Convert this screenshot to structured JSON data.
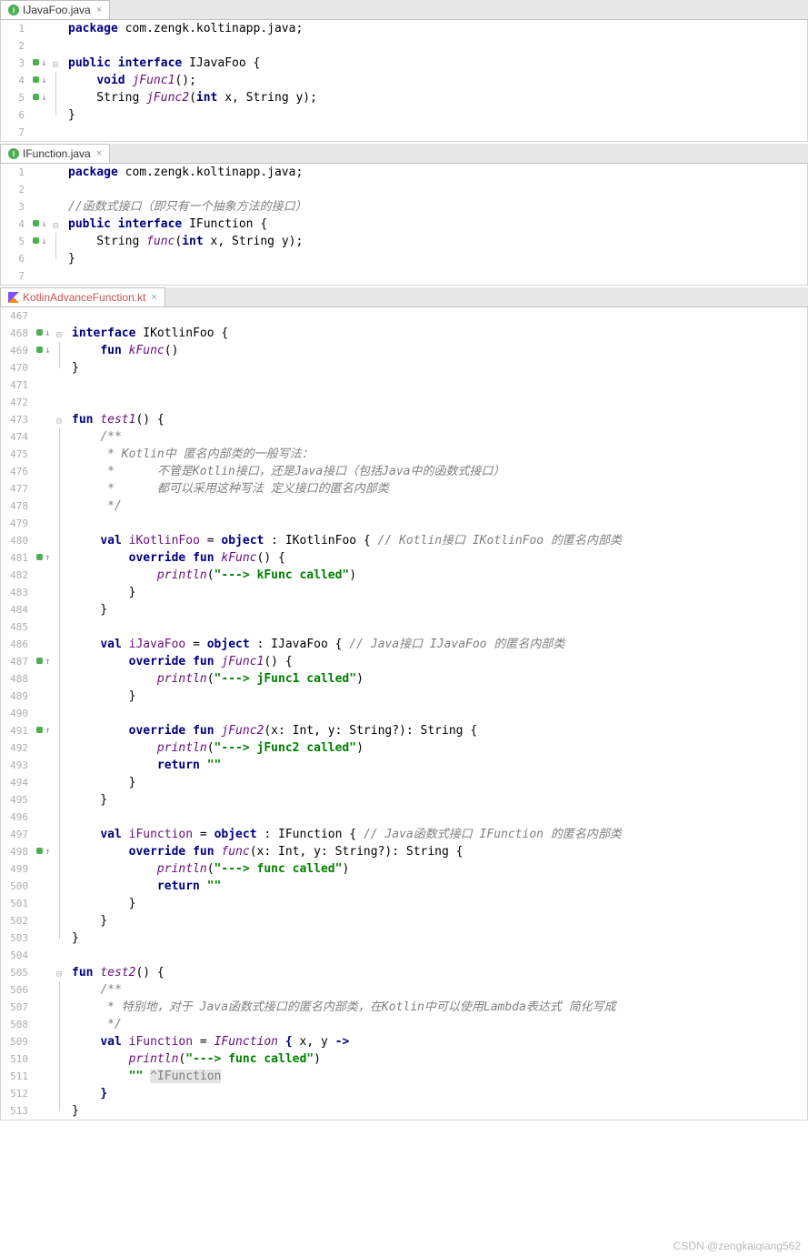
{
  "pane1": {
    "tab": "IJavaFoo.java",
    "lines": [
      {
        "n": "1",
        "code": [
          [
            "kw",
            "package "
          ],
          [
            "plain",
            "com.zengk.koltinapp.java;"
          ]
        ]
      },
      {
        "n": "2",
        "code": []
      },
      {
        "n": "3",
        "mk": "d",
        "fold": "t",
        "code": [
          [
            "kw",
            "public interface "
          ],
          [
            "plain",
            "IJavaFoo {"
          ]
        ]
      },
      {
        "n": "4",
        "mk": "d",
        "fold": "m",
        "code": [
          [
            "plain",
            "    "
          ],
          [
            "kw",
            "void "
          ],
          [
            "fn",
            "jFunc1"
          ],
          [
            "plain",
            "();"
          ]
        ]
      },
      {
        "n": "5",
        "mk": "d",
        "fold": "m",
        "code": [
          [
            "plain",
            "    String "
          ],
          [
            "fn",
            "jFunc2"
          ],
          [
            "plain",
            "("
          ],
          [
            "kw",
            "int "
          ],
          [
            "plain",
            "x, String y);"
          ]
        ]
      },
      {
        "n": "6",
        "fold": "b",
        "code": [
          [
            "plain",
            "}"
          ]
        ]
      },
      {
        "n": "7",
        "code": []
      }
    ]
  },
  "pane2": {
    "tab": "IFunction.java",
    "lines": [
      {
        "n": "1",
        "code": [
          [
            "kw",
            "package "
          ],
          [
            "plain",
            "com.zengk.koltinapp.java;"
          ]
        ]
      },
      {
        "n": "2",
        "code": []
      },
      {
        "n": "3",
        "code": [
          [
            "com",
            "//函数式接口（即只有一个抽象方法的接口）"
          ]
        ]
      },
      {
        "n": "4",
        "mk": "d",
        "fold": "t",
        "code": [
          [
            "kw",
            "public interface "
          ],
          [
            "plain",
            "IFunction {"
          ]
        ]
      },
      {
        "n": "5",
        "mk": "d",
        "fold": "m",
        "code": [
          [
            "plain",
            "    String "
          ],
          [
            "fn",
            "func"
          ],
          [
            "plain",
            "("
          ],
          [
            "kw",
            "int "
          ],
          [
            "plain",
            "x, String y);"
          ]
        ]
      },
      {
        "n": "6",
        "fold": "b",
        "code": [
          [
            "plain",
            "}"
          ]
        ]
      },
      {
        "n": "7",
        "code": []
      }
    ]
  },
  "pane3": {
    "tab": "KotlinAdvanceFunction.kt",
    "lines": [
      {
        "n": "467",
        "code": []
      },
      {
        "n": "468",
        "mk": "d",
        "fold": "t",
        "code": [
          [
            "kw",
            "interface "
          ],
          [
            "plain",
            "IKotlinFoo {"
          ]
        ]
      },
      {
        "n": "469",
        "mk": "d",
        "fold": "m",
        "code": [
          [
            "plain",
            "    "
          ],
          [
            "kw",
            "fun "
          ],
          [
            "fn",
            "kFunc"
          ],
          [
            "plain",
            "()"
          ]
        ]
      },
      {
        "n": "470",
        "fold": "b",
        "code": [
          [
            "plain",
            "}"
          ]
        ]
      },
      {
        "n": "471",
        "code": []
      },
      {
        "n": "472",
        "code": []
      },
      {
        "n": "473",
        "fold": "t",
        "code": [
          [
            "kw",
            "fun "
          ],
          [
            "fn",
            "test1"
          ],
          [
            "plain",
            "() {"
          ]
        ]
      },
      {
        "n": "474",
        "fold": "m",
        "code": [
          [
            "plain",
            "    "
          ],
          [
            "com",
            "/**"
          ]
        ]
      },
      {
        "n": "475",
        "fold": "m",
        "code": [
          [
            "com",
            "     * Kotlin中 匿名内部类的一般写法："
          ]
        ]
      },
      {
        "n": "476",
        "fold": "m",
        "code": [
          [
            "com",
            "     *      不管是Kotlin接口，还是Java接口（包括Java中的函数式接口）"
          ]
        ]
      },
      {
        "n": "477",
        "fold": "m",
        "code": [
          [
            "com",
            "     *      都可以采用这种写法 定义接口的匿名内部类"
          ]
        ]
      },
      {
        "n": "478",
        "fold": "m",
        "code": [
          [
            "com",
            "     */"
          ]
        ]
      },
      {
        "n": "479",
        "fold": "m",
        "code": []
      },
      {
        "n": "480",
        "fold": "m",
        "code": [
          [
            "plain",
            "    "
          ],
          [
            "kw",
            "val "
          ],
          [
            "lv",
            "iKotlinFoo"
          ],
          [
            "plain",
            " = "
          ],
          [
            "kw",
            "object"
          ],
          [
            "plain",
            " : IKotlinFoo { "
          ],
          [
            "com",
            "// Kotlin接口 IKotlinFoo 的匿名内部类"
          ]
        ]
      },
      {
        "n": "481",
        "mk": "u",
        "fold": "m",
        "code": [
          [
            "plain",
            "        "
          ],
          [
            "kw",
            "override fun "
          ],
          [
            "fn",
            "kFunc"
          ],
          [
            "plain",
            "() {"
          ]
        ]
      },
      {
        "n": "482",
        "fold": "m",
        "code": [
          [
            "plain",
            "            "
          ],
          [
            "fn",
            "println"
          ],
          [
            "plain",
            "("
          ],
          [
            "str",
            "\"---> kFunc called\""
          ],
          [
            "plain",
            ")"
          ]
        ]
      },
      {
        "n": "483",
        "fold": "m",
        "code": [
          [
            "plain",
            "        }"
          ]
        ]
      },
      {
        "n": "484",
        "fold": "m",
        "code": [
          [
            "plain",
            "    }"
          ]
        ]
      },
      {
        "n": "485",
        "fold": "m",
        "code": []
      },
      {
        "n": "486",
        "fold": "m",
        "code": [
          [
            "plain",
            "    "
          ],
          [
            "kw",
            "val "
          ],
          [
            "lv",
            "iJavaFoo"
          ],
          [
            "plain",
            " = "
          ],
          [
            "kw",
            "object"
          ],
          [
            "plain",
            " : IJavaFoo { "
          ],
          [
            "com",
            "// Java接口 IJavaFoo 的匿名内部类"
          ]
        ]
      },
      {
        "n": "487",
        "mk": "u",
        "fold": "m",
        "code": [
          [
            "plain",
            "        "
          ],
          [
            "kw",
            "override fun "
          ],
          [
            "fn",
            "jFunc1"
          ],
          [
            "plain",
            "() {"
          ]
        ]
      },
      {
        "n": "488",
        "fold": "m",
        "code": [
          [
            "plain",
            "            "
          ],
          [
            "fn",
            "println"
          ],
          [
            "plain",
            "("
          ],
          [
            "str",
            "\"---> jFunc1 called\""
          ],
          [
            "plain",
            ")"
          ]
        ]
      },
      {
        "n": "489",
        "fold": "m",
        "code": [
          [
            "plain",
            "        }"
          ]
        ]
      },
      {
        "n": "490",
        "fold": "m",
        "code": []
      },
      {
        "n": "491",
        "mk": "u",
        "fold": "m",
        "code": [
          [
            "plain",
            "        "
          ],
          [
            "kw",
            "override fun "
          ],
          [
            "fn",
            "jFunc2"
          ],
          [
            "plain",
            "(x: Int, y: String?): String {"
          ]
        ]
      },
      {
        "n": "492",
        "fold": "m",
        "code": [
          [
            "plain",
            "            "
          ],
          [
            "fn",
            "println"
          ],
          [
            "plain",
            "("
          ],
          [
            "str",
            "\"---> jFunc2 called\""
          ],
          [
            "plain",
            ")"
          ]
        ]
      },
      {
        "n": "493",
        "fold": "m",
        "code": [
          [
            "plain",
            "            "
          ],
          [
            "kw",
            "return "
          ],
          [
            "str",
            "\"\""
          ]
        ]
      },
      {
        "n": "494",
        "fold": "m",
        "code": [
          [
            "plain",
            "        }"
          ]
        ]
      },
      {
        "n": "495",
        "fold": "m",
        "code": [
          [
            "plain",
            "    }"
          ]
        ]
      },
      {
        "n": "496",
        "fold": "m",
        "code": []
      },
      {
        "n": "497",
        "fold": "m",
        "code": [
          [
            "plain",
            "    "
          ],
          [
            "kw",
            "val "
          ],
          [
            "lv",
            "iFunction"
          ],
          [
            "plain",
            " = "
          ],
          [
            "kw",
            "object"
          ],
          [
            "plain",
            " : IFunction { "
          ],
          [
            "com",
            "// Java函数式接口 IFunction 的匿名内部类"
          ]
        ]
      },
      {
        "n": "498",
        "mk": "u",
        "fold": "m",
        "code": [
          [
            "plain",
            "        "
          ],
          [
            "kw",
            "override fun "
          ],
          [
            "fn",
            "func"
          ],
          [
            "plain",
            "(x: Int, y: String?): String {"
          ]
        ]
      },
      {
        "n": "499",
        "fold": "m",
        "code": [
          [
            "plain",
            "            "
          ],
          [
            "fn",
            "println"
          ],
          [
            "plain",
            "("
          ],
          [
            "str",
            "\"---> func called\""
          ],
          [
            "plain",
            ")"
          ]
        ]
      },
      {
        "n": "500",
        "fold": "m",
        "code": [
          [
            "plain",
            "            "
          ],
          [
            "kw",
            "return "
          ],
          [
            "str",
            "\"\""
          ]
        ]
      },
      {
        "n": "501",
        "fold": "m",
        "code": [
          [
            "plain",
            "        }"
          ]
        ]
      },
      {
        "n": "502",
        "fold": "m",
        "code": [
          [
            "plain",
            "    }"
          ]
        ]
      },
      {
        "n": "503",
        "fold": "b",
        "code": [
          [
            "plain",
            "}"
          ]
        ]
      },
      {
        "n": "504",
        "code": []
      },
      {
        "n": "505",
        "fold": "t",
        "code": [
          [
            "kw",
            "fun "
          ],
          [
            "fn",
            "test2"
          ],
          [
            "plain",
            "() {"
          ]
        ]
      },
      {
        "n": "506",
        "fold": "m",
        "code": [
          [
            "plain",
            "    "
          ],
          [
            "com",
            "/**"
          ]
        ]
      },
      {
        "n": "507",
        "fold": "m",
        "code": [
          [
            "com",
            "     * 特别地，对于 Java函数式接口的匿名内部类，在Kotlin中可以使用Lambda表达式 简化写成"
          ]
        ]
      },
      {
        "n": "508",
        "fold": "m",
        "code": [
          [
            "com",
            "     */"
          ]
        ]
      },
      {
        "n": "509",
        "fold": "m",
        "code": [
          [
            "plain",
            "    "
          ],
          [
            "kw",
            "val "
          ],
          [
            "lv",
            "iFunction"
          ],
          [
            "plain",
            " = "
          ],
          [
            "fn",
            "IFunction"
          ],
          [
            "plain",
            " "
          ],
          [
            "kw",
            "{"
          ],
          [
            "plain",
            " x, y "
          ],
          [
            "kw",
            "->"
          ]
        ]
      },
      {
        "n": "510",
        "fold": "m",
        "code": [
          [
            "plain",
            "        "
          ],
          [
            "fn",
            "println"
          ],
          [
            "plain",
            "("
          ],
          [
            "str",
            "\"---> func called\""
          ],
          [
            "plain",
            ")"
          ]
        ]
      },
      {
        "n": "511",
        "fold": "m",
        "code": [
          [
            "plain",
            "        "
          ],
          [
            "str",
            "\"\""
          ],
          [
            "plain",
            " "
          ],
          [
            "hl",
            "^IFunction"
          ]
        ]
      },
      {
        "n": "512",
        "fold": "m",
        "code": [
          [
            "plain",
            "    "
          ],
          [
            "kw",
            "}"
          ]
        ]
      },
      {
        "n": "513",
        "fold": "b",
        "code": [
          [
            "plain",
            "}"
          ]
        ]
      }
    ]
  },
  "watermark": "CSDN @zengkaiqiang562"
}
